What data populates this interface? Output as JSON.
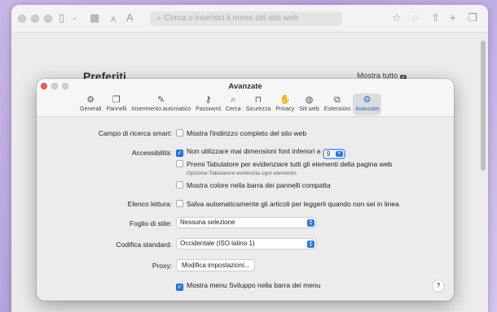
{
  "safari": {
    "address_placeholder": "Cerca o inserisci il nome del sito web",
    "favorites_title": "Preferiti",
    "show_all_label": "Mostra tutto",
    "font_small": "A",
    "font_large": "A"
  },
  "prefs": {
    "title": "Avanzate",
    "tabs": [
      {
        "label": "Generali",
        "icon": "gear-icon",
        "glyph": "⚙"
      },
      {
        "label": "Pannelli",
        "icon": "tabs-icon",
        "glyph": "❐"
      },
      {
        "label": "Inserimento automatico",
        "icon": "autofill-icon",
        "glyph": "✎"
      },
      {
        "label": "Password",
        "icon": "key-icon",
        "glyph": "⚷"
      },
      {
        "label": "Cerca",
        "icon": "search-icon",
        "glyph": "⌕"
      },
      {
        "label": "Sicurezza",
        "icon": "lock-icon",
        "glyph": "🔒"
      },
      {
        "label": "Privacy",
        "icon": "hand-icon",
        "glyph": "✋"
      },
      {
        "label": "Siti web",
        "icon": "globe-icon",
        "glyph": "🌐"
      },
      {
        "label": "Estensioni",
        "icon": "puzzle-icon",
        "glyph": "⧉"
      },
      {
        "label": "Avanzate",
        "icon": "advanced-gears-icon",
        "glyph": "⚙"
      }
    ],
    "active_tab": "Avanzate",
    "smart_search": {
      "label": "Campo di ricerca smart:",
      "option": "Mostra l'indirizzo completo del sito web",
      "checked": false
    },
    "accessibility": {
      "label": "Accessibilità:",
      "min_font_option": "Non utilizzare mai dimensioni font inferiori a",
      "min_font_checked": true,
      "min_font_value": "9",
      "tab_option": "Premi Tabulatore per evidenziare tutti gli elementi della pagina web",
      "tab_checked": false,
      "tab_hint": "Opzione-Tabulatore evidenzia ogni elemento.",
      "color_option": "Mostra colore nella barra dei pannelli compatta",
      "color_checked": false
    },
    "reading_list": {
      "label": "Elenco lettura:",
      "option": "Salva automaticamente gli articoli per leggerli quando non sei in linea",
      "checked": false
    },
    "stylesheet": {
      "label": "Foglio di stile:",
      "value": "Nessuna selezione"
    },
    "encoding": {
      "label": "Codifica standard:",
      "value": "Occidentale (ISO latino 1)"
    },
    "proxy": {
      "label": "Proxy:",
      "button": "Modifica impostazioni..."
    },
    "develop_menu": {
      "option": "Mostra menu Sviluppo nella barra dei menu",
      "checked": true
    },
    "help_label": "?"
  },
  "colors": {
    "accent": "#2b7be6",
    "close_red": "#ee5d56"
  }
}
